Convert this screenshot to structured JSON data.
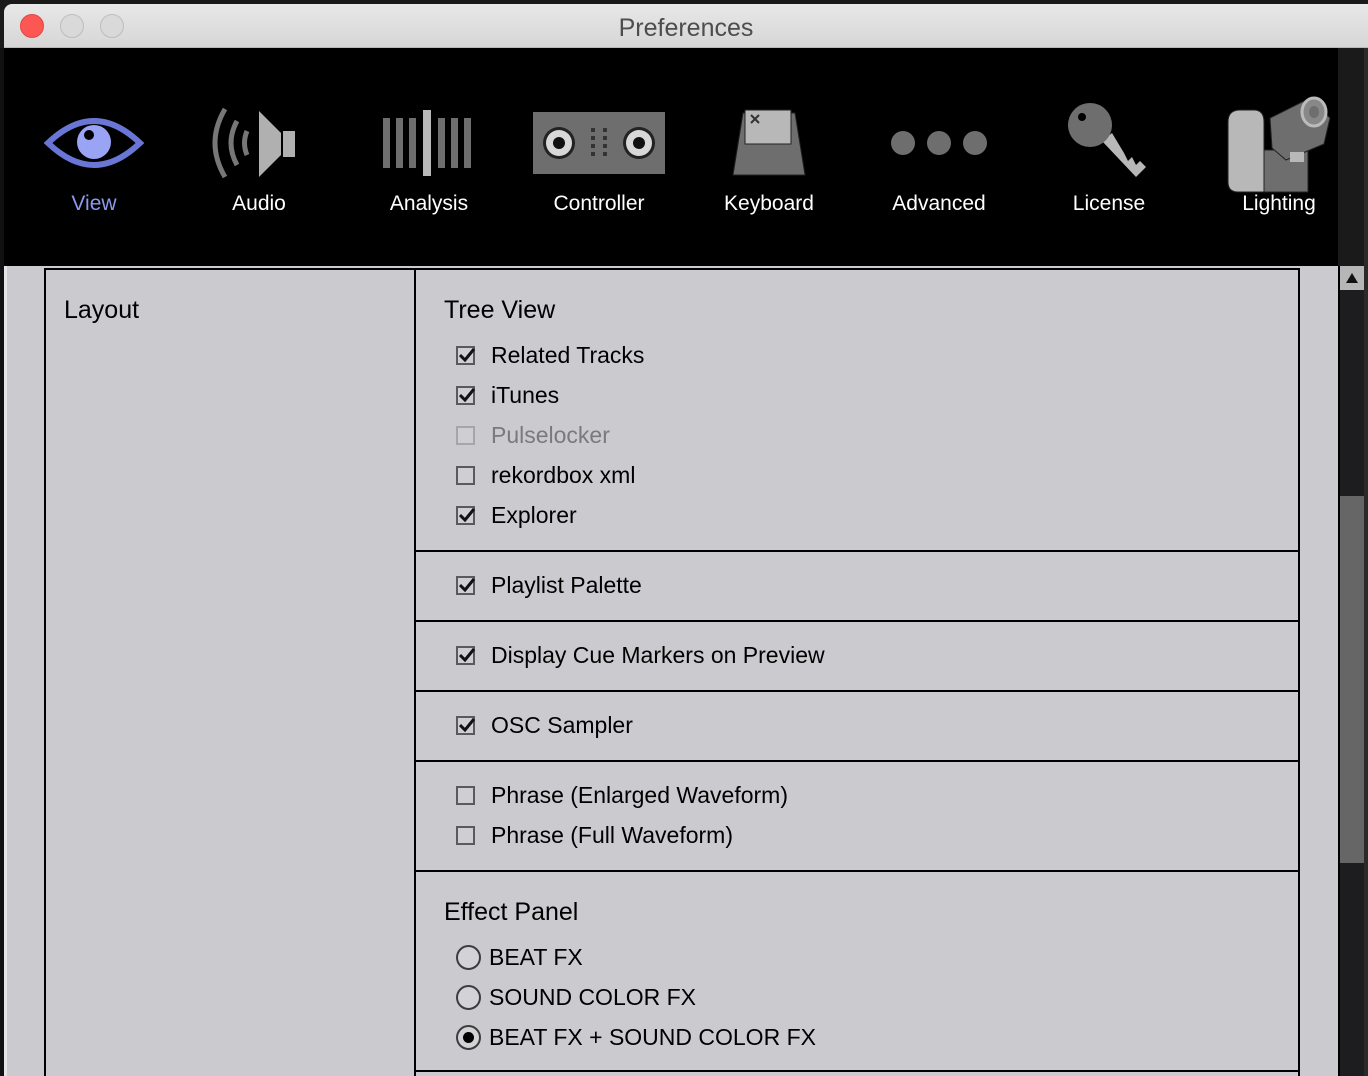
{
  "window": {
    "title": "Preferences"
  },
  "toolbar": {
    "items": [
      {
        "label": "View",
        "icon": "eye-icon",
        "active": true
      },
      {
        "label": "Audio",
        "icon": "speaker-icon",
        "active": false
      },
      {
        "label": "Analysis",
        "icon": "waveform-bars-icon",
        "active": false
      },
      {
        "label": "Controller",
        "icon": "controller-icon",
        "active": false
      },
      {
        "label": "Keyboard",
        "icon": "keycap-icon",
        "active": false
      },
      {
        "label": "Advanced",
        "icon": "ellipsis-icon",
        "active": false
      },
      {
        "label": "License",
        "icon": "key-icon",
        "active": false
      },
      {
        "label": "Lighting",
        "icon": "moving-head-light-icon",
        "active": false
      }
    ],
    "active_color": "#8d99ee"
  },
  "layout": {
    "category_label": "Layout",
    "tree_view": {
      "heading": "Tree View",
      "options": [
        {
          "label": "Related Tracks",
          "checked": true,
          "disabled": false
        },
        {
          "label": "iTunes",
          "checked": true,
          "disabled": false
        },
        {
          "label": "Pulselocker",
          "checked": false,
          "disabled": true
        },
        {
          "label": "rekordbox xml",
          "checked": false,
          "disabled": false
        },
        {
          "label": "Explorer",
          "checked": true,
          "disabled": false
        }
      ]
    },
    "playlist_palette": {
      "label": "Playlist Palette",
      "checked": true
    },
    "cue_markers": {
      "label": "Display Cue Markers on Preview",
      "checked": true
    },
    "osc_sampler": {
      "label": "OSC Sampler",
      "checked": true
    },
    "phrase": {
      "options": [
        {
          "label": "Phrase (Enlarged Waveform)",
          "checked": false
        },
        {
          "label": "Phrase (Full Waveform)",
          "checked": false
        }
      ]
    },
    "effect_panel": {
      "heading": "Effect Panel",
      "options": [
        {
          "label": "BEAT FX",
          "selected": false
        },
        {
          "label": "SOUND COLOR FX",
          "selected": false
        },
        {
          "label": "BEAT FX + SOUND COLOR FX",
          "selected": true
        }
      ]
    }
  },
  "scrollbar": {
    "position_fraction": 0.35
  }
}
